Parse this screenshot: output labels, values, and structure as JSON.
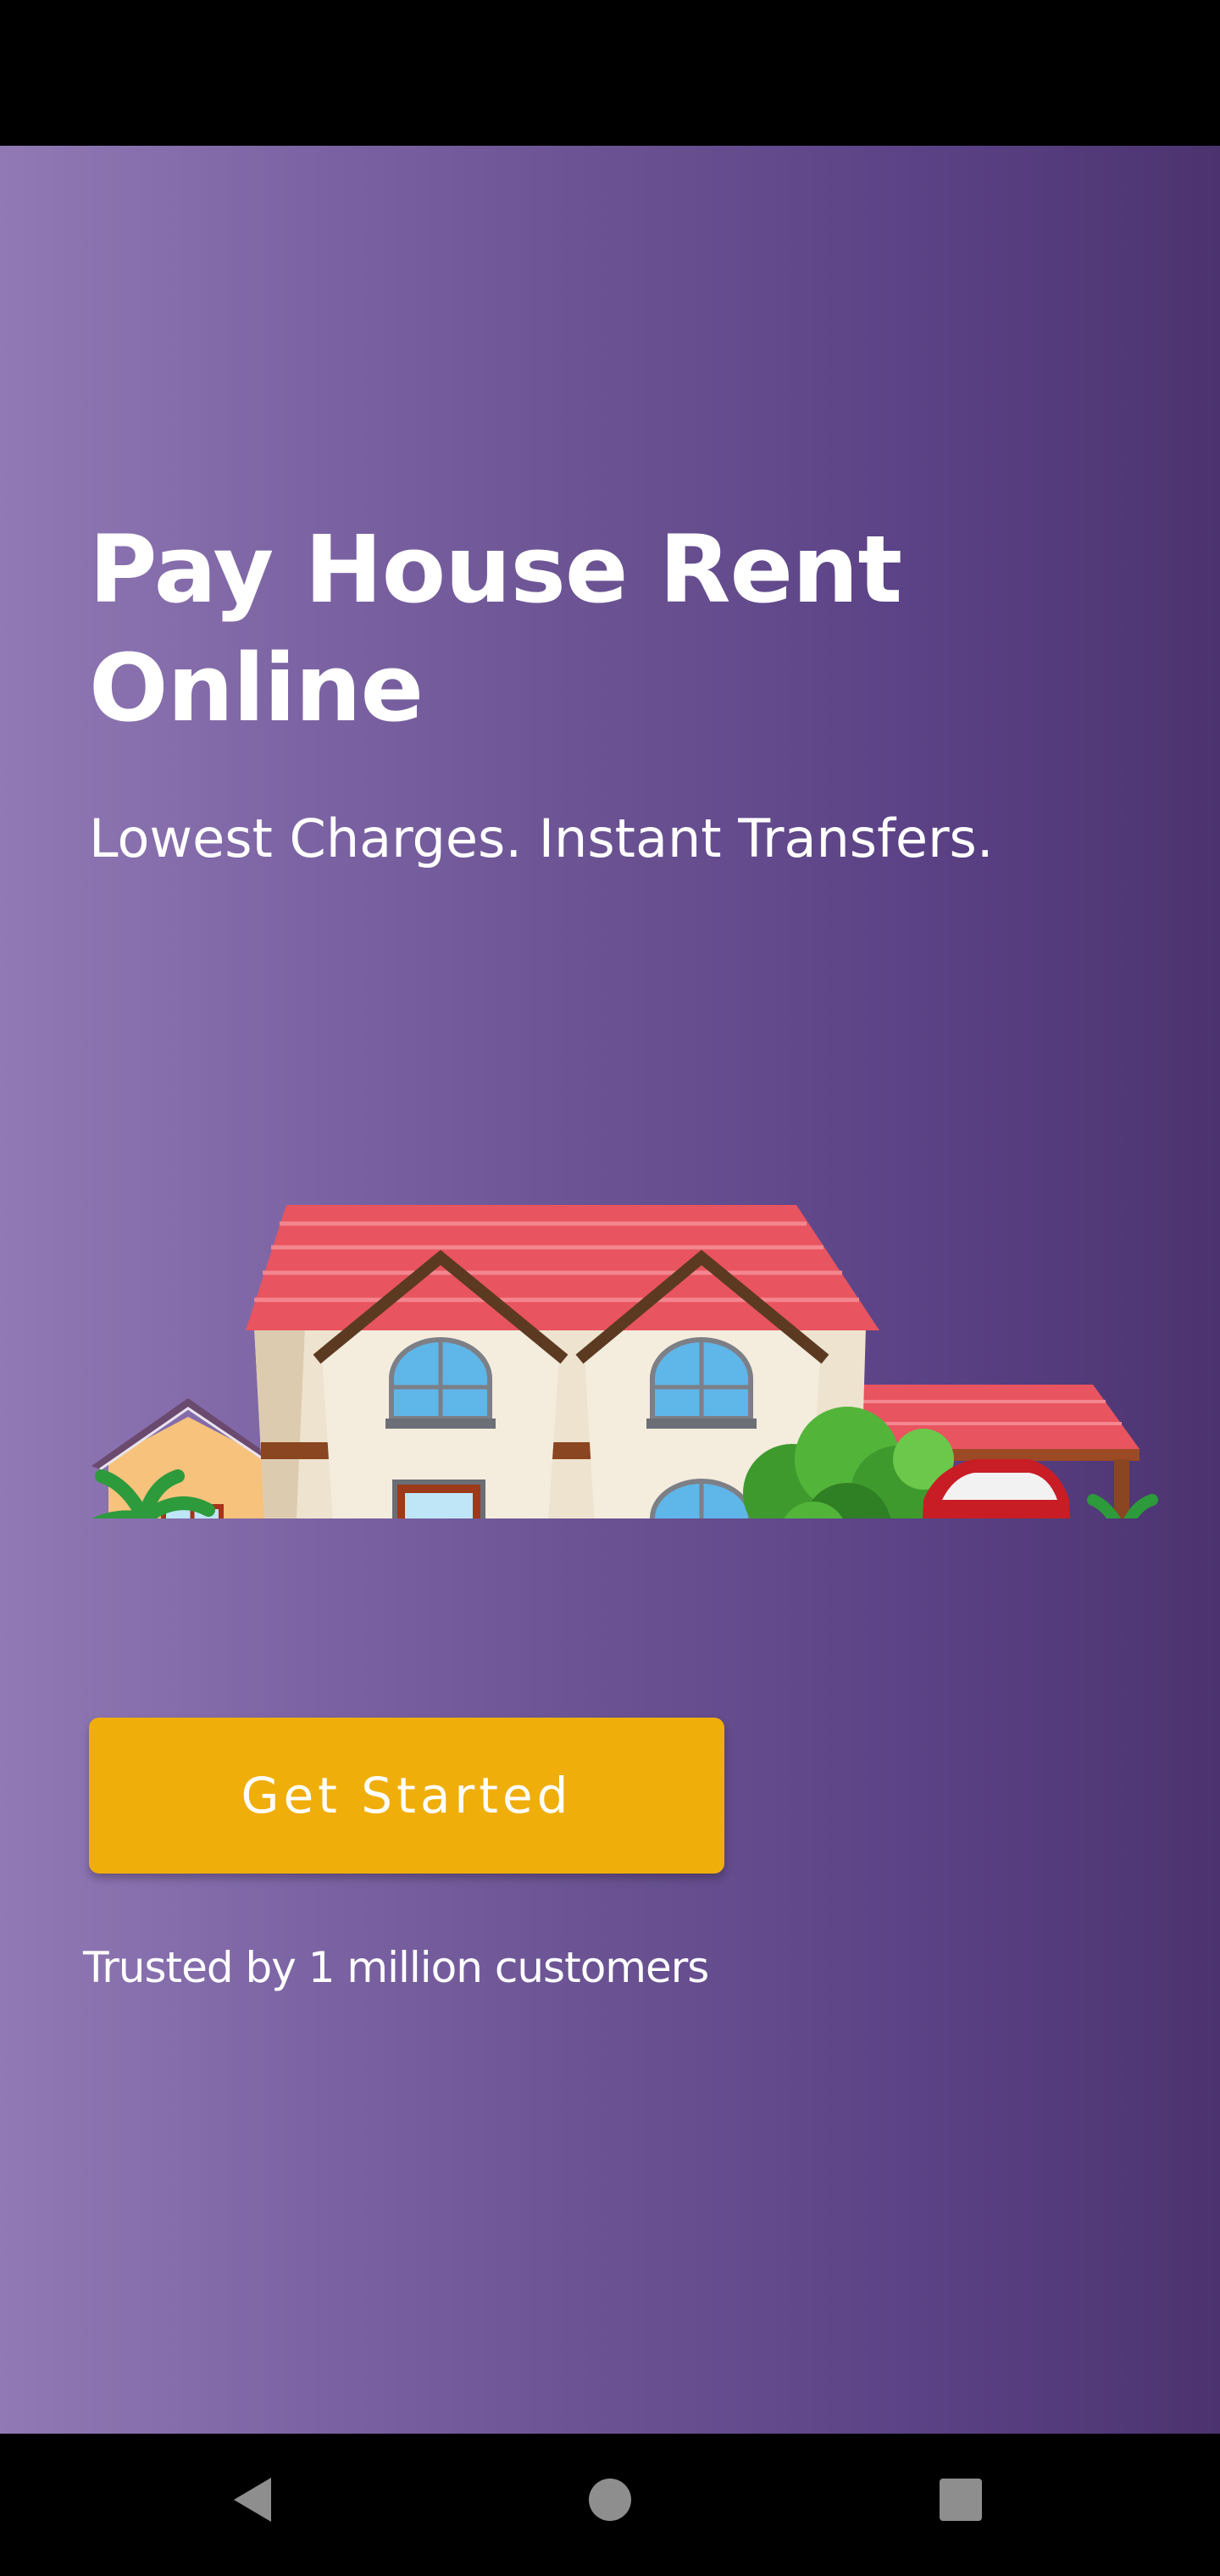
{
  "hero": {
    "title": "Pay House Rent Online",
    "subtitle": "Lowest Charges. Instant Transfers."
  },
  "illustration": {
    "icon": "house-with-car-illustration"
  },
  "cta": {
    "label": "Get Started"
  },
  "trust_text": "Trusted by 1 million customers",
  "navigation": {
    "back_icon": "triangle-back-icon",
    "home_icon": "circle-home-icon",
    "recents_icon": "square-recents-icon"
  },
  "colors": {
    "background_gradient_start": "#9179b5",
    "background_gradient_end": "#4c336f",
    "cta_background": "#f0ae0a",
    "text": "#ffffff"
  }
}
